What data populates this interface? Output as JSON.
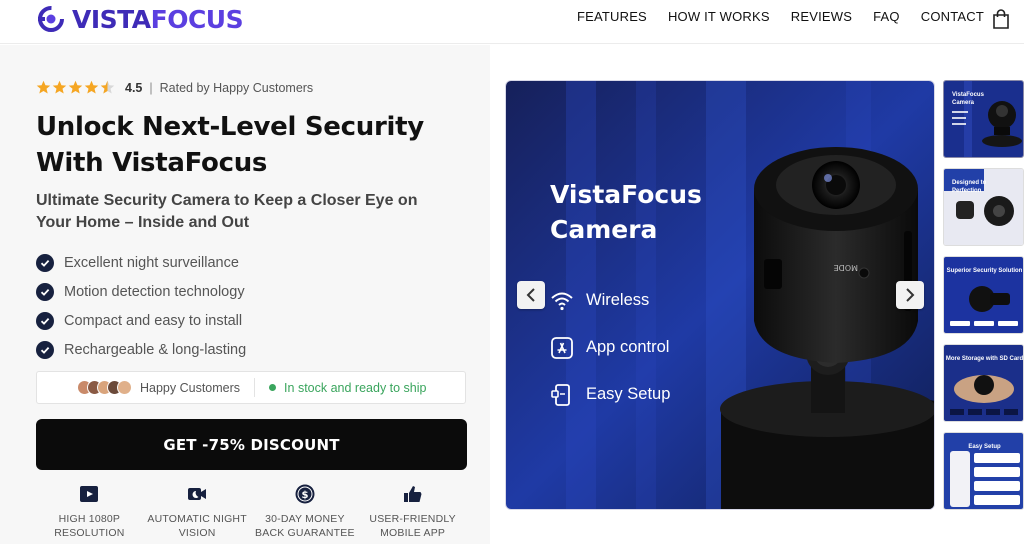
{
  "brand": {
    "name_part1": "VISTA",
    "name_part2": "FOCUS",
    "accent": "#3e2bb7"
  },
  "nav": {
    "items": [
      "FEATURES",
      "HOW IT WORKS",
      "REVIEWS",
      "FAQ",
      "CONTACT"
    ],
    "cart_icon": "shopping-bag-icon"
  },
  "hero": {
    "rating": {
      "value": "4.5",
      "separator": "|",
      "text": "Rated by Happy Customers",
      "stars": 4.5
    },
    "headline": "Unlock Next-Level Security With VistaFocus",
    "subheadline": "Ultimate Security Camera to Keep a Closer Eye on Your Home – Inside and Out",
    "features": [
      "Excellent night surveillance",
      "Motion detection technology",
      "Compact and easy to install",
      "Rechargeable & long-lasting"
    ],
    "social": {
      "customers_label": "Happy Customers",
      "stock_label": "In stock and ready to ship",
      "stock_color": "#3aa55d"
    },
    "cta_label": "GET -75% DISCOUNT",
    "perks": [
      {
        "icon": "video-play-icon",
        "label": "HIGH 1080P RESOLUTION"
      },
      {
        "icon": "moon-camera-icon",
        "label": "AUTOMATIC NIGHT VISION"
      },
      {
        "icon": "dollar-coin-icon",
        "label": "30-DAY MONEY BACK GUARANTEE"
      },
      {
        "icon": "thumbs-up-icon",
        "label": "USER-FRIENDLY MOBILE APP"
      }
    ]
  },
  "gallery": {
    "main": {
      "title_line1": "VistaFocus",
      "title_line2": "Camera",
      "features": [
        {
          "icon": "wifi-icon",
          "label": "Wireless"
        },
        {
          "icon": "app-store-icon",
          "label": "App control"
        },
        {
          "icon": "phone-setup-icon",
          "label": "Easy Setup"
        }
      ],
      "camera_text": "MODE"
    },
    "thumbnails": [
      {
        "caption": "VistaFocus Camera"
      },
      {
        "caption": "Designed to Perfection"
      },
      {
        "caption": "Superior Security Solution"
      },
      {
        "caption": "More Storage with SD Card"
      },
      {
        "caption": "Easy Setup"
      }
    ]
  }
}
